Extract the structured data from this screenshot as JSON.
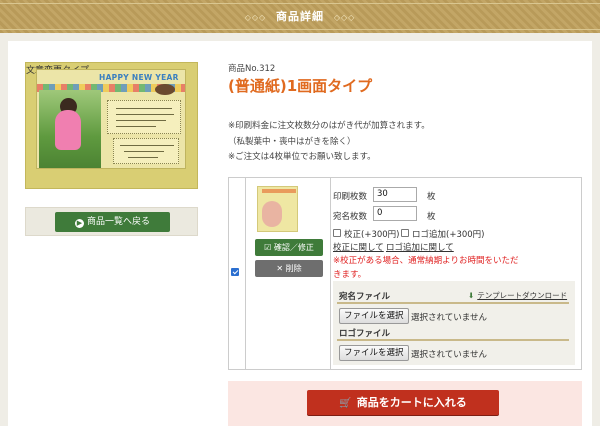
{
  "header": {
    "title": "商品詳細",
    "deco_left": "◇◇◇",
    "deco_right": "◇◇◇"
  },
  "product": {
    "image": {
      "greeting": "HAPPY NEW YEAR",
      "badge": "文章変更タイプ"
    },
    "back_button": "商品一覧へ戻る",
    "number": "商品No.312",
    "name": "(普通紙)1画面タイプ",
    "notes": [
      "※印刷料金に注文枚数分のはがき代が加算されます。",
      "（私製葉中・喪中はがきを除く）",
      "※ご注文は4枚単位でお願い致します。"
    ]
  },
  "order": {
    "row_checked": true,
    "confirm_button": "確認／修正",
    "delete_button": "削除",
    "print_count_label": "印刷枚数",
    "print_count_value": "30",
    "name_count_label": "宛名枚数",
    "name_count_value": "0",
    "unit": "枚",
    "option_proof": "校正(+300円)",
    "option_logo": "ロゴ追加(+300円)",
    "link_proof": "校正に関して",
    "link_logo": "ロゴ追加に関して",
    "warning": "※校正がある場合、通常納期よりお時間をいただきます。",
    "address_file_label": "宛名ファイル",
    "template_download": "テンプレートダウンロード",
    "choose_file_label": "ファイルを選択",
    "no_file_text": "選択されていません",
    "logo_file_label": "ロゴファイル"
  },
  "cart_button": "商品をカートに入れる",
  "colors": {
    "accent_orange": "#e06a1f",
    "button_green": "#3f7b3a",
    "cart_red": "#c0301e",
    "warning_red": "#e02222",
    "header_gold": "#b89a59"
  }
}
